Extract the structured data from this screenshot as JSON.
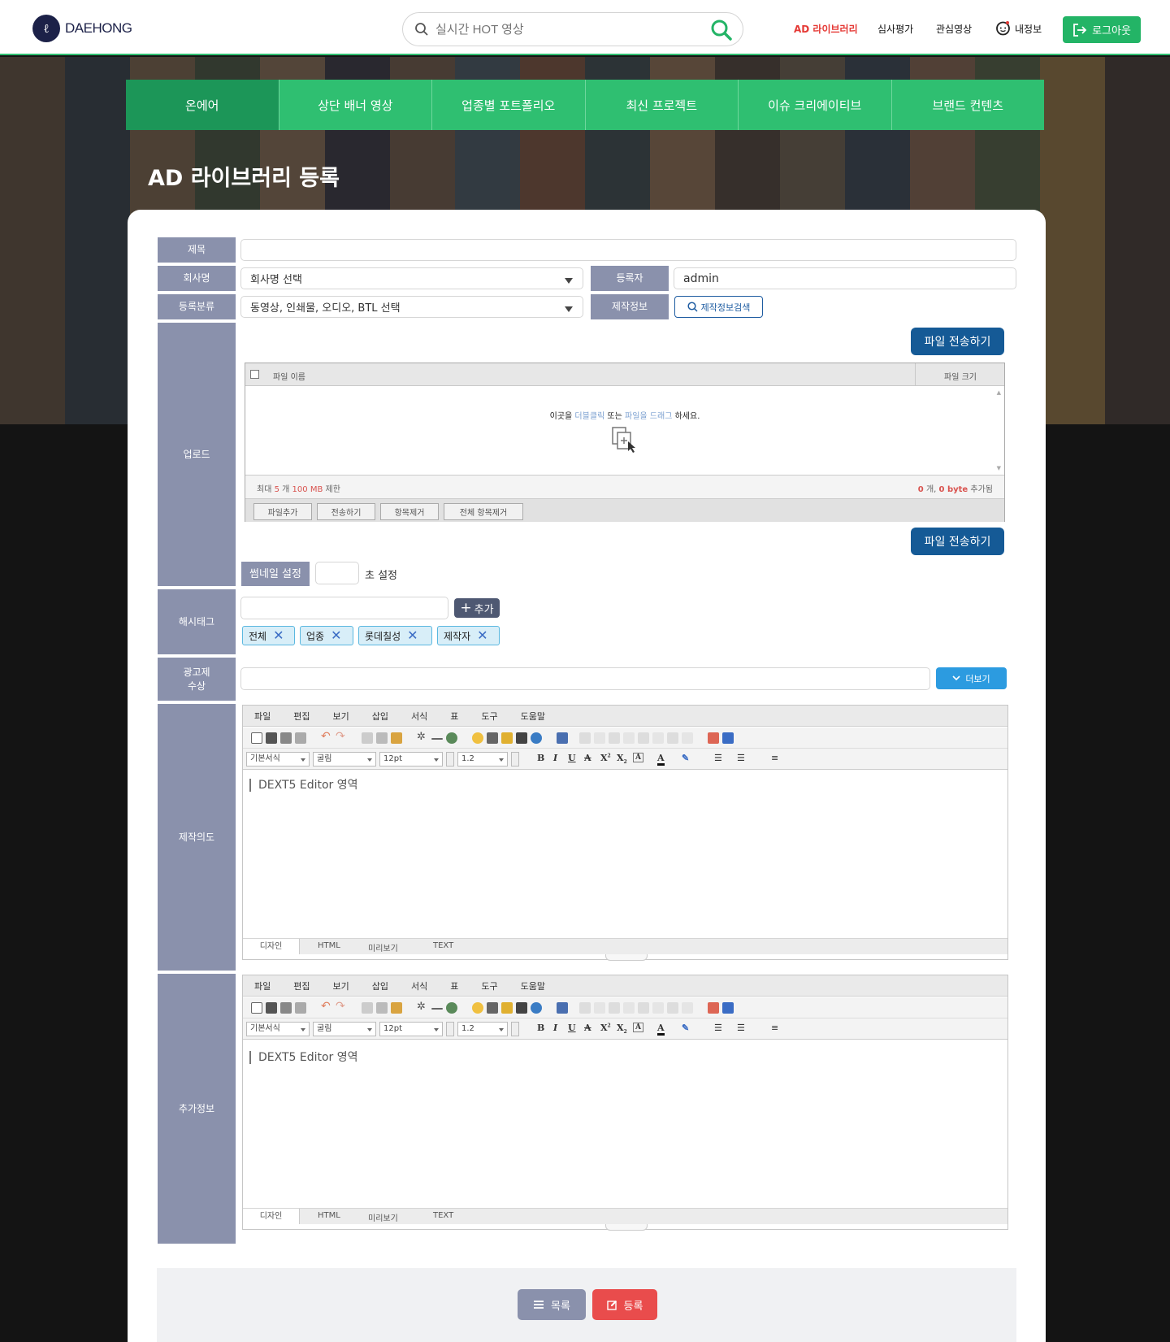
{
  "brand": {
    "name": "DAEHONG"
  },
  "header": {
    "search_placeholder": "실시간 HOT 영상",
    "nav": [
      "AD 라이브러리",
      "심사평가",
      "관심영상",
      "내정보"
    ],
    "logout": "로그아웃",
    "accent_color": "#e53935",
    "brand_green": "#23b466"
  },
  "tabs": [
    "온에어",
    "상단 배너 영상",
    "업종별 포트폴리오",
    "최신 프로젝트",
    "이슈 크리에이티브",
    "브랜드 컨텐츠"
  ],
  "page_title": "AD 라이브러리 등록",
  "form": {
    "title_label": "제목",
    "title_value": "",
    "company_label": "회사명",
    "company_value": "회사명 선택",
    "registrant_label": "등록자",
    "registrant_value": "admin",
    "category_label": "등록분류",
    "category_value": "동영상, 인쇄물, 오디오, BTL 선택",
    "production_label": "제작정보",
    "production_search": "제작정보검색",
    "upload_label": "업로드",
    "send_button": "파일 전송하기",
    "uploader": {
      "col_name": "파일 이름",
      "col_size": "파일 크기",
      "drop_pre": "이곳을",
      "drop_dbl": "더블클릭",
      "drop_or": "또는",
      "drop_drag": "파일을 드래그",
      "drop_post": "하세요.",
      "limit_pre": "최대",
      "limit_count": "5",
      "limit_mid": "개",
      "limit_size": "100 MB",
      "limit_post": "제한",
      "added_count": "0",
      "added_mid": "개,",
      "added_size": "0 byte",
      "added_post": "추가됨",
      "buttons": [
        "파일추가",
        "전송하기",
        "항목제거",
        "전체 항목제거"
      ]
    },
    "thumbnail_label": "썸네일 설정",
    "thumbnail_value": "",
    "thumbnail_suffix": "초 설정",
    "hashtag_label": "해시태그",
    "hashtag_value": "",
    "hashtag_add": "추가",
    "hashtags": [
      "전체",
      "업종",
      "롯데칠성",
      "제작자"
    ],
    "award_label": "광고제\n수상",
    "award_value": "",
    "more_button": "더보기",
    "intent_label": "제작의도",
    "extra_label": "추가정보"
  },
  "editor": {
    "menu": [
      "파일",
      "편집",
      "보기",
      "삽입",
      "서식",
      "표",
      "도구",
      "도움말"
    ],
    "style_select": "기본서식",
    "font_select": "굴림",
    "size_select": "12pt",
    "line_select": "1.2",
    "placeholder": "DEXT5 Editor 영역",
    "tabs": [
      "디자인",
      "HTML",
      "미리보기",
      "TEXT"
    ]
  },
  "actions": {
    "list": "목록",
    "submit": "등록"
  }
}
